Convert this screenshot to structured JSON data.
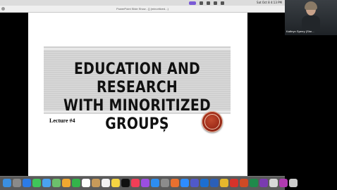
{
  "menubar": {
    "clock": "Sat Oct 8  4:13 PM"
  },
  "window": {
    "title": "PowerPoint Slide Show - [",
    "title_suffix": "] (minoritized...)"
  },
  "slide": {
    "title_line1": "EDUCATION AND RESEARCH",
    "title_line2": "WITH MINORITIZED GROUPS",
    "lecture": "Lecture #4"
  },
  "video": {
    "participant": "Kathryn Sperry (She..."
  },
  "dock": {
    "apps": [
      {
        "name": "finder",
        "color": "#3b8fe0"
      },
      {
        "name": "launchpad",
        "color": "#8a8a8a"
      },
      {
        "name": "safari",
        "color": "#2c7be5"
      },
      {
        "name": "messages",
        "color": "#3fc55a"
      },
      {
        "name": "mail",
        "color": "#4aa3f0"
      },
      {
        "name": "maps",
        "color": "#6cc06c"
      },
      {
        "name": "photos",
        "color": "#f0a830"
      },
      {
        "name": "facetime",
        "color": "#34b34a"
      },
      {
        "name": "calendar",
        "color": "#ffffff"
      },
      {
        "name": "contacts",
        "color": "#c79a5a"
      },
      {
        "name": "reminders",
        "color": "#f2f2f2"
      },
      {
        "name": "notes",
        "color": "#f5d442"
      },
      {
        "name": "tv",
        "color": "#111111"
      },
      {
        "name": "music",
        "color": "#f03e57"
      },
      {
        "name": "podcasts",
        "color": "#9b4ee0"
      },
      {
        "name": "appstore",
        "color": "#2d8df0"
      },
      {
        "name": "settings",
        "color": "#8c8c8c"
      },
      {
        "name": "firefox",
        "color": "#e9702f"
      },
      {
        "name": "zoom",
        "color": "#2d8cff"
      },
      {
        "name": "teams",
        "color": "#5059c9"
      },
      {
        "name": "outlook",
        "color": "#1c6ed1"
      },
      {
        "name": "word",
        "color": "#2b5fb8"
      },
      {
        "name": "chrome",
        "color": "#e5b82c"
      },
      {
        "name": "acrobat",
        "color": "#d6322a"
      },
      {
        "name": "powerpoint",
        "color": "#d04a25"
      },
      {
        "name": "excel",
        "color": "#1f8a4b"
      },
      {
        "name": "onenote",
        "color": "#7a3bb0"
      },
      {
        "name": "preview",
        "color": "#d9d9d9"
      },
      {
        "name": "app-purple",
        "color": "#b03ab0"
      },
      {
        "name": "trash",
        "color": "#cccccc"
      }
    ]
  }
}
